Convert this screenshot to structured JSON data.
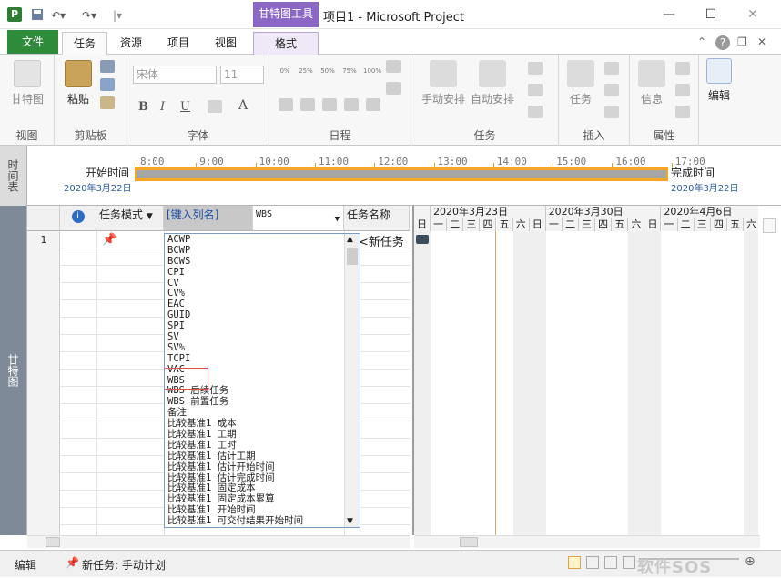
{
  "titlebar": {
    "app_icon": "P",
    "context_tab": "甘特图工具",
    "title": "项目1 - Microsoft Project",
    "qat_save_icon": "save-icon",
    "qat_undo_icon": "undo-icon",
    "qat_redo_icon": "redo-icon"
  },
  "tabs": {
    "file": "文件",
    "task": "任务",
    "resource": "资源",
    "project": "项目",
    "view": "视图",
    "format": "格式"
  },
  "ribbon": {
    "view_group": {
      "gantt": "甘特图",
      "label": "视图"
    },
    "clipboard": {
      "paste": "粘贴",
      "label": "剪贴板"
    },
    "font": {
      "family": "宋体",
      "size": "11",
      "bold": "B",
      "italic": "I",
      "underline": "U",
      "font_color": "A",
      "label": "字体"
    },
    "schedule": {
      "p0": "0%",
      "p25": "25%",
      "p50": "50%",
      "p75": "75%",
      "p100": "100%",
      "label": "日程"
    },
    "tasks": {
      "manual": "手动安排",
      "auto": "自动安排",
      "label": "任务"
    },
    "insert": {
      "task": "任务",
      "label": "插入"
    },
    "properties": {
      "info": "信息",
      "label": "属性"
    },
    "editing": {
      "edit": "编辑"
    }
  },
  "timeline": {
    "side_label": "时间表",
    "start_label": "开始时间",
    "start_date": "2020年3月22日",
    "end_label": "完成时间",
    "end_date": "2020年3月22日",
    "ticks": [
      "8:00",
      "9:00",
      "10:00",
      "11:00",
      "12:00",
      "13:00",
      "14:00",
      "15:00",
      "16:00",
      "17:00"
    ]
  },
  "grid": {
    "side_label": "甘特图",
    "headers": {
      "info": "i",
      "task_mode": "任务模式",
      "new_column": "[键入列名]",
      "wbs": "WBS",
      "task_name": "任务名称"
    },
    "row1": {
      "num": "1",
      "name": "<新任务"
    }
  },
  "gantt": {
    "weeks": [
      "2020年3月23日",
      "2020年3月30日",
      "2020年4月6日"
    ],
    "days": [
      "日",
      "一",
      "二",
      "三",
      "四",
      "五",
      "六",
      "日",
      "一",
      "二",
      "三",
      "四",
      "五",
      "六",
      "日",
      "一",
      "二",
      "三",
      "四",
      "五",
      "六"
    ]
  },
  "dropdown_items": [
    "ACWP",
    "BCWP",
    "BCWS",
    "CPI",
    "CV",
    "CV%",
    "EAC",
    "GUID",
    "SPI",
    "SV",
    "SV%",
    "TCPI",
    "VAC",
    "WBS",
    "WBS 后续任务",
    "WBS 前置任务",
    "备注",
    "比较基准1 成本",
    "比较基准1 工期",
    "比较基准1 工时",
    "比较基准1 估计工期",
    "比较基准1 估计开始时间",
    "比较基准1 估计完成时间",
    "比较基准1 固定成本",
    "比较基准1 固定成本累算",
    "比较基准1 开始时间",
    "比较基准1 可交付结果开始时间"
  ],
  "status": {
    "mode": "编辑",
    "new_task": "新任务: 手动计划"
  },
  "watermark": "软件SOS",
  "colors": {
    "file_tab": "#2e8b3a",
    "context_tab": "#8c68c6",
    "timeline_border": "#f6a623"
  }
}
